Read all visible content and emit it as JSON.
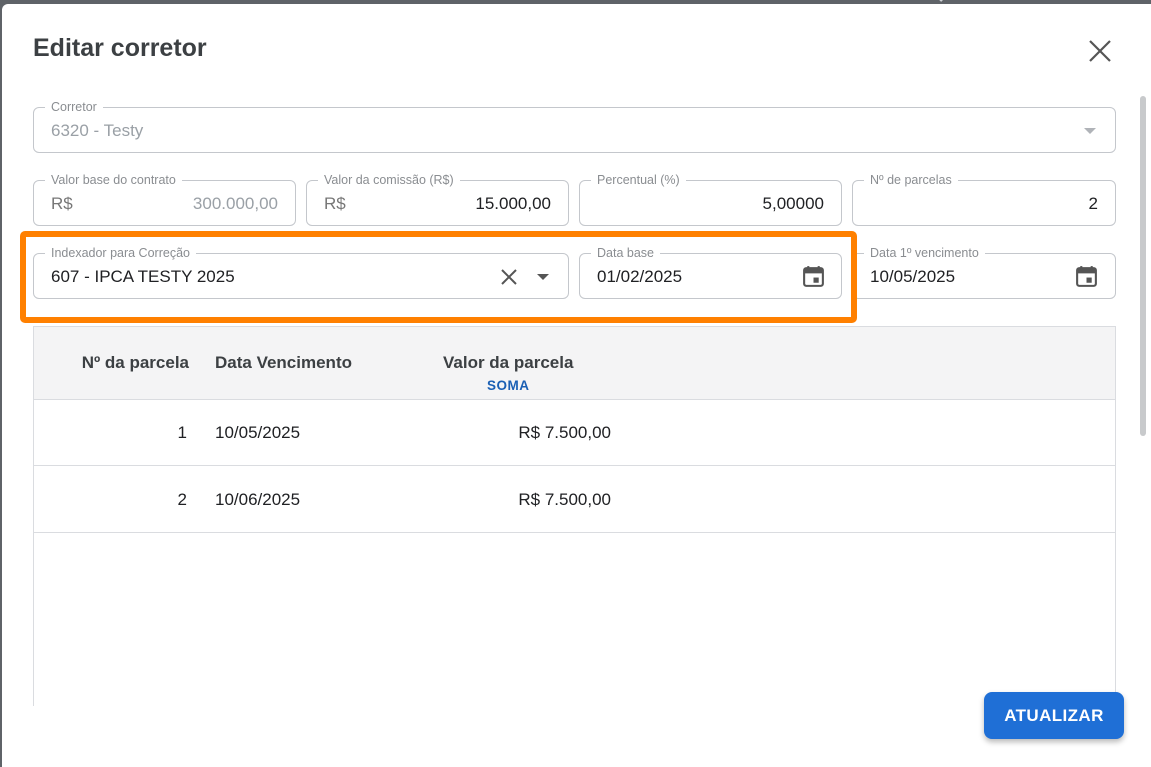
{
  "dialog": {
    "title": "Editar corretor"
  },
  "form": {
    "corretor": {
      "label": "Corretor",
      "value": "6320 - Testy"
    },
    "valor_base": {
      "label": "Valor base do contrato",
      "prefix": "R$",
      "value": "300.000,00"
    },
    "valor_comissao": {
      "label": "Valor da comissão (R$)",
      "prefix": "R$",
      "value": "15.000,00"
    },
    "percentual": {
      "label": "Percentual (%)",
      "value": "5,00000"
    },
    "num_parcelas": {
      "label": "Nº de parcelas",
      "value": "2"
    },
    "indexador": {
      "label": "Indexador para Correção",
      "value": "607 - IPCA TESTY 2025"
    },
    "data_base": {
      "label": "Data base",
      "value": "01/02/2025"
    },
    "data_vencimento": {
      "label": "Data 1º vencimento",
      "value": "10/05/2025"
    }
  },
  "table": {
    "headers": {
      "parcela": "Nº da parcela",
      "data": "Data Vencimento",
      "valor": "Valor da parcela",
      "valor_sub": "SOMA"
    },
    "rows": [
      {
        "parcela": "1",
        "data": "10/05/2025",
        "valor": "R$ 7.500,00"
      },
      {
        "parcela": "2",
        "data": "10/06/2025",
        "valor": "R$ 7.500,00"
      }
    ]
  },
  "actions": {
    "update_label": "ATUALIZAR"
  },
  "colors": {
    "highlight": "#ff8000",
    "primary": "#1f6fd6",
    "soma": "#1a5fb4"
  },
  "icons": [
    "close-icon",
    "dropdown-arrow-icon",
    "clear-icon",
    "calendar-icon",
    "search-icon"
  ]
}
